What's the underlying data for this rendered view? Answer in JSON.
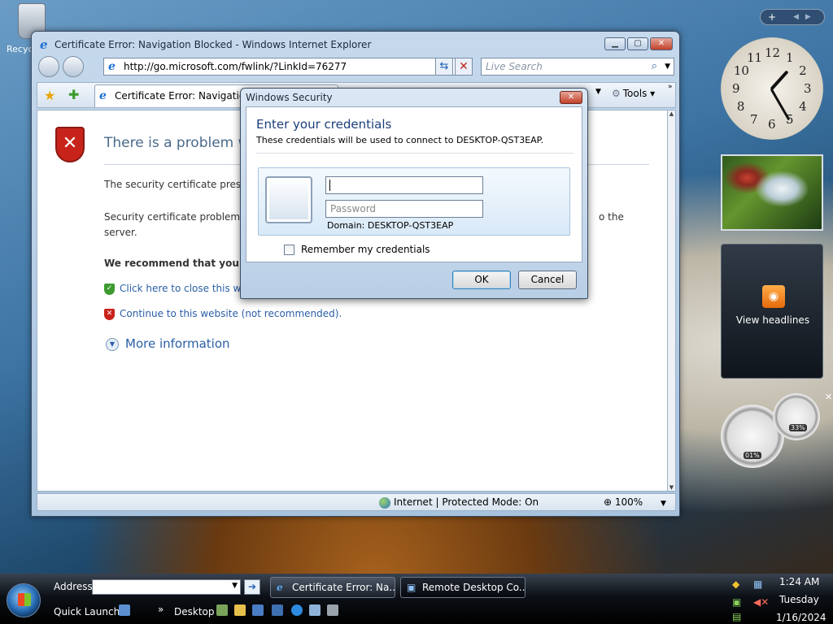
{
  "desktop": {
    "recycle_label": "Recyc"
  },
  "ie": {
    "title": "Certificate Error: Navigation Blocked - Windows Internet Explorer",
    "address": "http://go.microsoft.com/fwlink/?LinkId=76277",
    "search_placeholder": "Live Search",
    "tab_label": "Certificate Error: Navigation B",
    "tools_label": "Tools",
    "page": {
      "heading": "There is a problem w",
      "p1": "The security certificate prese",
      "p2_a": "Security certificate problems",
      "p2_tail": "o the",
      "p2_b": "server.",
      "recommend": "We recommend that you",
      "link_close": "Click here to close this w",
      "link_continue": "Continue to this website (not recommended).",
      "more_info": "More information"
    },
    "status": {
      "zone": "Internet | Protected Mode: On",
      "zoom": "100%"
    }
  },
  "dialog": {
    "title": "Windows Security",
    "heading": "Enter your credentials",
    "subtitle": "These credentials will be used to connect to DESKTOP-QST3EAP.",
    "username_value": "",
    "password_placeholder": "Password",
    "domain": "Domain: DESKTOP-QST3EAP",
    "remember": "Remember my credentials",
    "ok": "OK",
    "cancel": "Cancel"
  },
  "sidebar": {
    "rss_label": "View headlines",
    "clock_numbers": [
      "12",
      "1",
      "2",
      "3",
      "4",
      "5",
      "6",
      "7",
      "8",
      "9",
      "10",
      "11"
    ],
    "cpu": "01%",
    "mem": "33%"
  },
  "taskbar": {
    "address_label": "Address",
    "quick_launch_label": "Quick Launch",
    "desktop_label": "Desktop",
    "tasks": [
      "Certificate Error: Na...",
      "Remote Desktop Co..."
    ],
    "time": "1:24 AM",
    "day": "Tuesday",
    "date": "1/16/2024"
  }
}
